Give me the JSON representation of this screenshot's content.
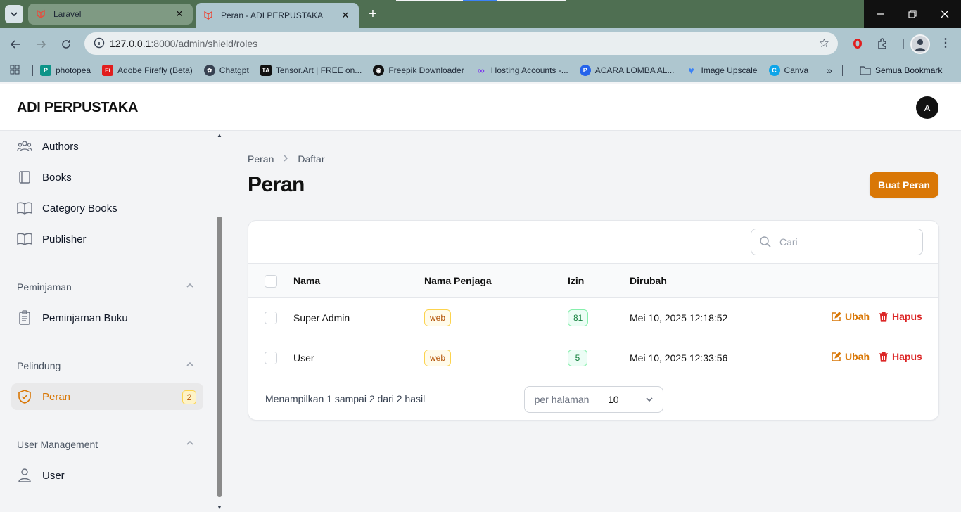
{
  "browser": {
    "tabs": [
      {
        "title": "Laravel",
        "active": false
      },
      {
        "title": "Peran - ADI PERPUSTAKA",
        "active": true
      }
    ],
    "url_host": "127.0.0.1",
    "url_path": ":8000/admin/shield/roles",
    "bookmarks": [
      {
        "label": "photopea",
        "icon_color": "#0d9488"
      },
      {
        "label": "Adobe Firefly (Beta)",
        "icon_color": "#e11d1d"
      },
      {
        "label": "Chatgpt",
        "icon_color": "#374151"
      },
      {
        "label": "Tensor.Art | FREE on...",
        "icon_color": "#111111"
      },
      {
        "label": "Freepik Downloader",
        "icon_color": "#111111"
      },
      {
        "label": "Hosting Accounts -...",
        "icon_color": "#7c3aed"
      },
      {
        "label": "ACARA LOMBA AL...",
        "icon_color": "#2563eb"
      },
      {
        "label": "Image Upscale",
        "icon_color": "#3b82f6"
      },
      {
        "label": "Canva",
        "icon_color": "#0ea5e9"
      }
    ],
    "bookmarks_folder": "Semua Bookmark"
  },
  "app": {
    "brand": "ADI PERPUSTAKA",
    "avatar_initial": "A",
    "accent": "#d97706"
  },
  "sidebar": {
    "items": [
      {
        "label": "Authors",
        "icon": "users-icon"
      },
      {
        "label": "Books",
        "icon": "book-icon"
      },
      {
        "label": "Category Books",
        "icon": "book-open-icon"
      },
      {
        "label": "Publisher",
        "icon": "book-open-icon"
      }
    ],
    "groups": [
      {
        "label": "Peminjaman",
        "items": [
          {
            "label": "Peminjaman Buku",
            "icon": "clipboard-icon"
          }
        ]
      },
      {
        "label": "Pelindung",
        "items": [
          {
            "label": "Peran",
            "icon": "shield-check-icon",
            "badge": "2",
            "active": true
          }
        ]
      },
      {
        "label": "User Management",
        "items": [
          {
            "label": "User",
            "icon": "user-icon"
          }
        ]
      }
    ]
  },
  "page": {
    "breadcrumb": [
      "Peran",
      "Daftar"
    ],
    "title": "Peran",
    "create_button": "Buat Peran"
  },
  "table": {
    "search_placeholder": "Cari",
    "columns": [
      "Nama",
      "Nama Penjaga",
      "Izin",
      "Dirubah"
    ],
    "rows": [
      {
        "name": "Super Admin",
        "guard": "web",
        "permissions": "81",
        "updated": "Mei 10, 2025 12:18:52"
      },
      {
        "name": "User",
        "guard": "web",
        "permissions": "5",
        "updated": "Mei 10, 2025 12:33:56"
      }
    ],
    "edit_label": "Ubah",
    "delete_label": "Hapus",
    "showing_text": "Menampilkan 1 sampai 2 dari 2 hasil",
    "per_page_label": "per halaman",
    "per_page_value": "10"
  }
}
